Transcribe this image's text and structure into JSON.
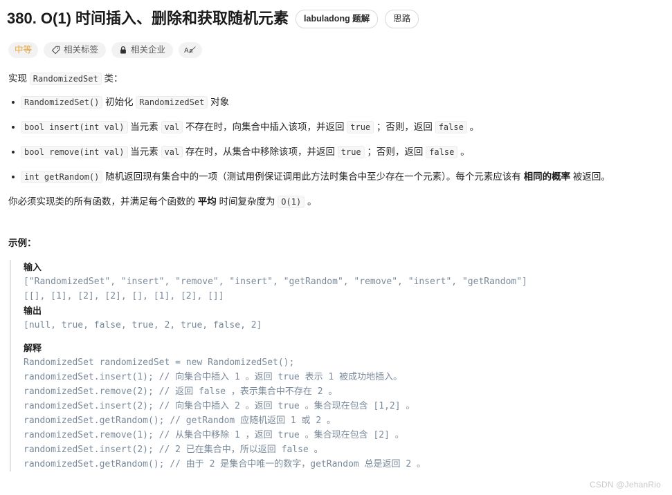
{
  "header": {
    "title": "380. O(1) 时间插入、删除和获取随机元素",
    "buttons": [
      {
        "label": "labuladong 题解",
        "bold": true
      },
      {
        "label": "思路",
        "bold": false
      }
    ]
  },
  "meta": {
    "difficulty": "中等",
    "tags_label": "相关标签",
    "companies_label": "相关企业",
    "font_icon_label": "Aa"
  },
  "description": {
    "intro_prefix": "实现",
    "intro_code": "RandomizedSet",
    "intro_suffix": "类：",
    "bullets": [
      {
        "code": "RandomizedSet()",
        "t1": "初始化",
        "code2": "RandomizedSet",
        "t2": "对象"
      },
      {
        "code": "bool insert(int val)",
        "t1": "当元素",
        "code2": "val",
        "t2": "不存在时，向集合中插入该项，并返回",
        "code3": "true",
        "t3": "；否则，返回",
        "code4": "false",
        "t4": "。"
      },
      {
        "code": "bool remove(int val)",
        "t1": "当元素",
        "code2": "val",
        "t2": "存在时，从集合中移除该项，并返回",
        "code3": "true",
        "t3": "；否则，返回",
        "code4": "false",
        "t4": "。"
      },
      {
        "code": "int getRandom()",
        "t1": "随机返回现有集合中的一项（测试用例保证调用此方法时集合中至少存在一个元素）。每个元素应该有",
        "bold": "相同的概率",
        "t2": "被返回。"
      }
    ],
    "closing": {
      "p1": "你必须实现类的所有函数，并满足每个函数的",
      "bold": "平均",
      "p2": "时间复杂度为",
      "code": "O(1)",
      "p3": "。"
    }
  },
  "example": {
    "heading": "示例：",
    "input_label": "输入",
    "input_line1": "[\"RandomizedSet\", \"insert\", \"remove\", \"insert\", \"getRandom\", \"remove\", \"insert\", \"getRandom\"]",
    "input_line2": "[[], [1], [2], [2], [], [1], [2], []]",
    "output_label": "输出",
    "output_line": "[null, true, false, true, 2, true, false, 2]",
    "explain_label": "解释",
    "explain_lines": "RandomizedSet randomizedSet = new RandomizedSet();\nrandomizedSet.insert(1); // 向集合中插入 1 。返回 true 表示 1 被成功地插入。\nrandomizedSet.remove(2); // 返回 false ，表示集合中不存在 2 。\nrandomizedSet.insert(2); // 向集合中插入 2 。返回 true 。集合现在包含 [1,2] 。\nrandomizedSet.getRandom(); // getRandom 应随机返回 1 或 2 。\nrandomizedSet.remove(1); // 从集合中移除 1 ，返回 true 。集合现在包含 [2] 。\nrandomizedSet.insert(2); // 2 已在集合中，所以返回 false 。\nrandomizedSet.getRandom(); // 由于 2 是集合中唯一的数字，getRandom 总是返回 2 。"
  },
  "watermark": "CSDN @JehanRio",
  "colors": {
    "difficulty": "#e8a33d",
    "code_text": "#7a8a9a",
    "border": "#e3e3e3"
  }
}
